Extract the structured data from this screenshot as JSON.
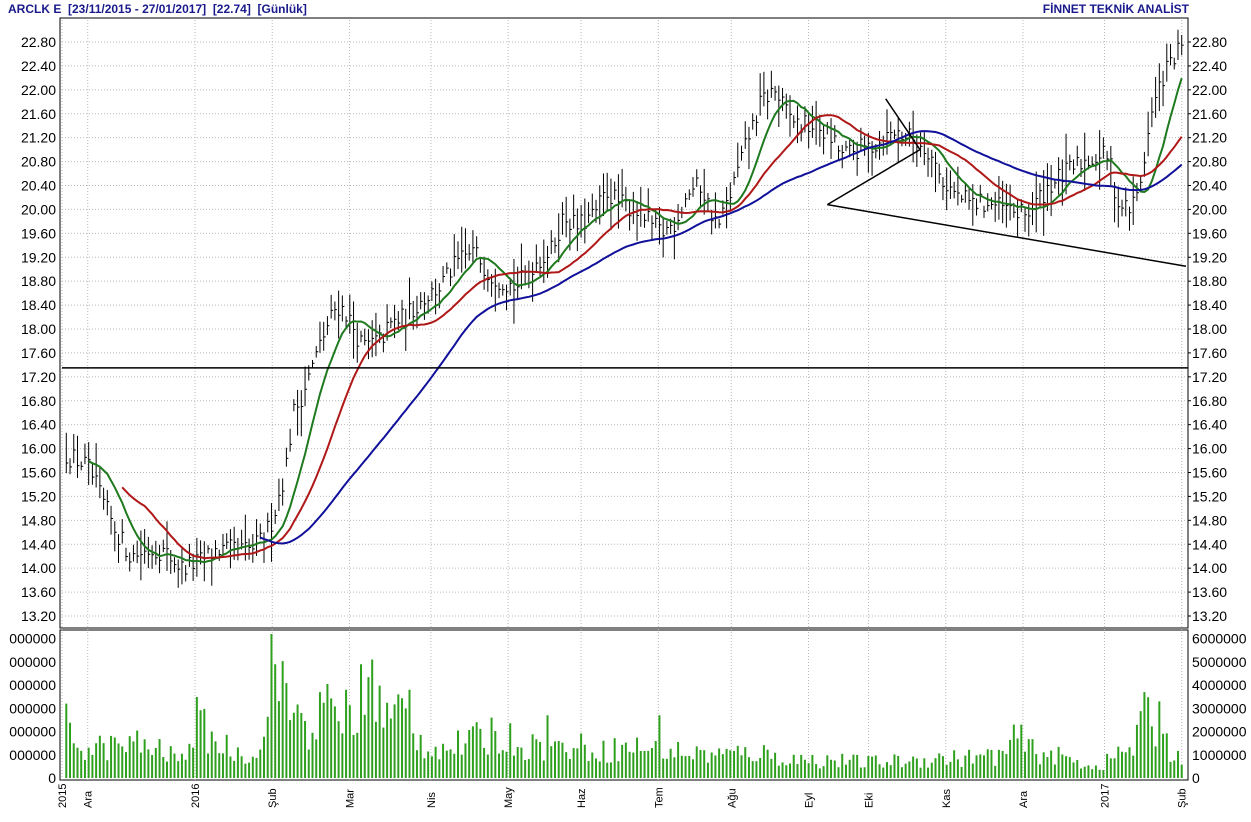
{
  "header": {
    "symbol": "ARCLK E",
    "range": "[23/11/2015 - 27/01/2017]",
    "last": "[22.74]",
    "period": "[Günlük]",
    "brand": "FİNNET TEKNİK ANALİST"
  },
  "colors": {
    "ma_short": "#1f7a1f",
    "ma_mid": "#b01818",
    "ma_long": "#10109a",
    "volume": "#2ea01e",
    "bars": "#000000",
    "grid": "#b9b9b9"
  },
  "chart_data": [
    {
      "type": "line",
      "name": "price",
      "ylim": [
        13.0,
        23.0
      ],
      "yticks": [
        "22.80",
        "22.40",
        "22.00",
        "21.60",
        "21.20",
        "20.80",
        "20.40",
        "20.00",
        "19.60",
        "19.20",
        "18.80",
        "18.40",
        "18.00",
        "17.60",
        "17.20",
        "16.80",
        "16.40",
        "16.00",
        "15.60",
        "15.20",
        "14.80",
        "14.40",
        "14.00",
        "13.60",
        "13.20"
      ],
      "x_labels": [
        "2015",
        "Ara",
        "2016",
        "Şub",
        "Mar",
        "Nis",
        "May",
        "Haz",
        "Tem",
        "Ağu",
        "Eyl",
        "Eki",
        "Kas",
        "Ara",
        "2017",
        "Şub"
      ],
      "x_label_positions": [
        0,
        0.3,
        1.55,
        2.45,
        3.35,
        4.3,
        5.2,
        6.05,
        6.95,
        7.8,
        8.7,
        9.4,
        10.3,
        11.2,
        12.15,
        13.05
      ],
      "x_range": [
        0,
        13.1
      ],
      "price_anchors": [
        [
          0.05,
          15.9
        ],
        [
          0.3,
          15.7
        ],
        [
          0.6,
          14.7
        ],
        [
          0.8,
          14.2
        ],
        [
          1.0,
          14.3
        ],
        [
          1.15,
          14.3
        ],
        [
          1.25,
          14.2
        ],
        [
          1.4,
          14.0
        ],
        [
          1.6,
          14.1
        ],
        [
          1.8,
          14.3
        ],
        [
          2.2,
          14.3
        ],
        [
          2.35,
          14.5
        ],
        [
          2.45,
          14.8
        ],
        [
          2.6,
          15.6
        ],
        [
          2.7,
          16.6
        ],
        [
          2.8,
          16.9
        ],
        [
          2.9,
          17.3
        ],
        [
          3.05,
          17.9
        ],
        [
          3.2,
          18.4
        ],
        [
          3.3,
          18.3
        ],
        [
          3.5,
          17.7
        ],
        [
          3.7,
          17.8
        ],
        [
          3.85,
          18.1
        ],
        [
          4.0,
          18.2
        ],
        [
          4.2,
          18.5
        ],
        [
          4.4,
          18.7
        ],
        [
          4.6,
          19.1
        ],
        [
          4.8,
          19.3
        ],
        [
          5.0,
          18.9
        ],
        [
          5.3,
          18.7
        ],
        [
          5.5,
          19.1
        ],
        [
          5.7,
          19.3
        ],
        [
          5.85,
          19.9
        ],
        [
          6.0,
          19.7
        ],
        [
          6.2,
          19.9
        ],
        [
          6.35,
          20.3
        ],
        [
          6.5,
          20.1
        ],
        [
          6.7,
          20.0
        ],
        [
          6.9,
          19.7
        ],
        [
          7.0,
          19.6
        ],
        [
          7.15,
          19.8
        ],
        [
          7.3,
          20.3
        ],
        [
          7.45,
          20.4
        ],
        [
          7.55,
          20.0
        ],
        [
          7.65,
          19.7
        ],
        [
          7.8,
          20.3
        ],
        [
          8.0,
          21.2
        ],
        [
          8.15,
          21.8
        ],
        [
          8.3,
          22.0
        ],
        [
          8.45,
          21.6
        ],
        [
          8.6,
          21.4
        ],
        [
          8.8,
          21.4
        ],
        [
          8.95,
          21.2
        ],
        [
          9.1,
          20.9
        ],
        [
          9.3,
          21.0
        ],
        [
          9.5,
          21.1
        ],
        [
          9.7,
          21.3
        ],
        [
          9.9,
          21.2
        ],
        [
          10.1,
          21.0
        ],
        [
          10.25,
          20.5
        ],
        [
          10.45,
          20.2
        ],
        [
          10.6,
          20.1
        ],
        [
          10.8,
          20.1
        ],
        [
          11.0,
          20.0
        ],
        [
          11.2,
          19.9
        ],
        [
          11.3,
          20.0
        ],
        [
          11.5,
          20.4
        ],
        [
          11.7,
          20.6
        ],
        [
          11.9,
          20.8
        ],
        [
          12.1,
          20.9
        ],
        [
          12.2,
          20.9
        ],
        [
          12.3,
          20.1
        ],
        [
          12.45,
          20.0
        ],
        [
          12.55,
          20.3
        ],
        [
          12.7,
          21.6
        ],
        [
          12.85,
          22.3
        ],
        [
          12.95,
          22.5
        ],
        [
          13.05,
          22.7
        ]
      ],
      "ma_short_start": 0.3,
      "ma_mid_start": 0.7,
      "ma_long_start": 2.3,
      "support_line": 17.35,
      "trendlines": [
        {
          "x1": 8.92,
          "y1": 20.08,
          "x2": 13.1,
          "y2": 19.05
        },
        {
          "x1": 8.92,
          "y1": 20.08,
          "x2": 10.0,
          "y2": 21.0
        },
        {
          "x1": 9.6,
          "y1": 21.85,
          "x2": 10.0,
          "y2": 21.0
        }
      ]
    },
    {
      "type": "bar",
      "name": "volume",
      "ylim": [
        0,
        6500000
      ],
      "yticks": [
        {
          "value": 6000000,
          "right": "6000000",
          "left": "000000"
        },
        {
          "value": 5000000,
          "right": "5000000",
          "left": "000000"
        },
        {
          "value": 4000000,
          "right": "4000000",
          "left": "000000"
        },
        {
          "value": 3000000,
          "right": "3000000",
          "left": "000000"
        },
        {
          "value": 2000000,
          "right": "2000000",
          "left": "000000"
        },
        {
          "value": 1000000,
          "right": "1000000",
          "left": "000000"
        },
        {
          "value": 0,
          "right": "0",
          "left": "0"
        }
      ],
      "volume_anchors": [
        [
          0.0,
          3400000
        ],
        [
          0.1,
          2000000
        ],
        [
          0.3,
          1500000
        ],
        [
          0.6,
          1600000
        ],
        [
          0.9,
          1700000
        ],
        [
          1.2,
          1300000
        ],
        [
          1.4,
          900000
        ],
        [
          1.55,
          2900000
        ],
        [
          1.8,
          1800000
        ],
        [
          2.1,
          1200000
        ],
        [
          2.35,
          1500000
        ],
        [
          2.45,
          5600000
        ],
        [
          2.55,
          4300000
        ],
        [
          2.75,
          3200000
        ],
        [
          2.9,
          2400000
        ],
        [
          3.1,
          3500000
        ],
        [
          3.3,
          2700000
        ],
        [
          3.45,
          2400000
        ],
        [
          3.6,
          4200000
        ],
        [
          3.8,
          3000000
        ],
        [
          4.0,
          3200000
        ],
        [
          4.2,
          1700000
        ],
        [
          4.5,
          1500000
        ],
        [
          4.8,
          1900000
        ],
        [
          5.1,
          2100000
        ],
        [
          5.4,
          1700000
        ],
        [
          5.7,
          1500000
        ],
        [
          6.0,
          1600000
        ],
        [
          6.3,
          1400000
        ],
        [
          6.6,
          1500000
        ],
        [
          6.9,
          1600000
        ],
        [
          7.2,
          1300000
        ],
        [
          7.5,
          1200000
        ],
        [
          7.8,
          1200000
        ],
        [
          8.1,
          1300000
        ],
        [
          8.4,
          1000000
        ],
        [
          8.7,
          900000
        ],
        [
          9.0,
          900000
        ],
        [
          9.3,
          800000
        ],
        [
          9.6,
          800000
        ],
        [
          9.9,
          900000
        ],
        [
          10.2,
          1000000
        ],
        [
          10.5,
          1000000
        ],
        [
          10.8,
          1100000
        ],
        [
          11.0,
          1200000
        ],
        [
          11.1,
          2300000
        ],
        [
          11.3,
          1400000
        ],
        [
          11.5,
          1200000
        ],
        [
          11.7,
          1000000
        ],
        [
          11.9,
          700000
        ],
        [
          12.1,
          600000
        ],
        [
          12.3,
          1200000
        ],
        [
          12.5,
          1600000
        ],
        [
          12.6,
          3400000
        ],
        [
          12.75,
          2500000
        ],
        [
          12.9,
          1600000
        ],
        [
          13.05,
          1000000
        ]
      ],
      "volume_spikes": [
        [
          2.45,
          6200000
        ],
        [
          2.5,
          4900000
        ],
        [
          3.5,
          4900000
        ],
        [
          3.62,
          5100000
        ],
        [
          3.3,
          3800000
        ],
        [
          3.0,
          3700000
        ],
        [
          2.78,
          2800000
        ],
        [
          3.9,
          3600000
        ],
        [
          4.05,
          3800000
        ],
        [
          5.0,
          2600000
        ],
        [
          5.65,
          2700000
        ],
        [
          6.95,
          2700000
        ],
        [
          12.6,
          3700000
        ],
        [
          12.78,
          3300000
        ],
        [
          11.08,
          2300000
        ]
      ],
      "x_range": [
        0,
        13.1
      ]
    }
  ]
}
